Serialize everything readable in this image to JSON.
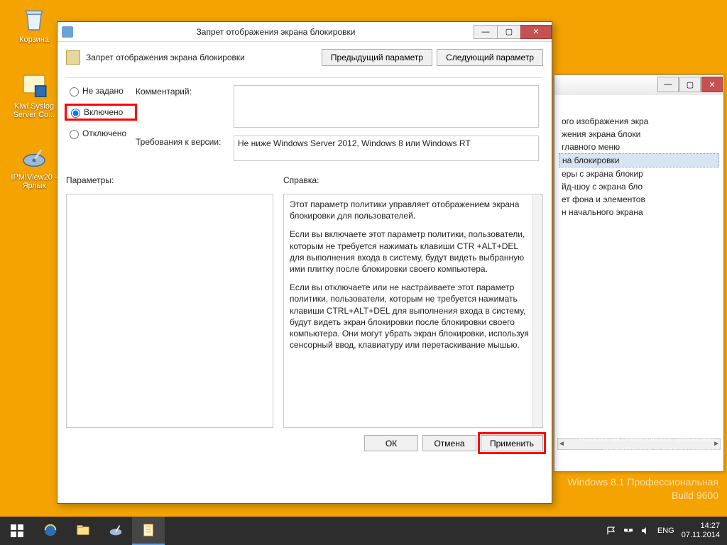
{
  "desktop": {
    "icons": [
      {
        "label": "Корзина"
      },
      {
        "label": "Kiwi Syslog Server Co..."
      },
      {
        "label": "IPMIView20 - Ярлык"
      }
    ]
  },
  "bg_window": {
    "items": [
      "ого изображения экра",
      "жения экрана блоки",
      "главного меню",
      "на блокировки",
      "еры с экрана блокир",
      "йд-шоу с экрана бло",
      "ет фона и элементов",
      "н начального экрана"
    ],
    "selected_index": 3
  },
  "dialog": {
    "title": "Запрет отображения экрана блокировки",
    "header_text": "Запрет отображения экрана блокировки",
    "prev_btn": "Предыдущий параметр",
    "next_btn": "Следующий параметр",
    "radios": {
      "not_configured": "Не задано",
      "enabled": "Включено",
      "disabled": "Отключено",
      "selected": "enabled"
    },
    "comment_label": "Комментарий:",
    "comment_value": "",
    "requirements_label": "Требования к версии:",
    "requirements_value": "Не ниже Windows Server 2012, Windows 8 или Windows RT",
    "params_label": "Параметры:",
    "help_label": "Справка:",
    "help_p1": "Этот параметр политики управляет отображением экрана блокировки для пользователей.",
    "help_p2": "Если вы включаете этот параметр политики, пользователи, которым не требуется нажимать клавиши CTR +ALT+DEL для выполнения входа в систему, будут видеть выбранную ими плитку после блокировки своего компьютера.",
    "help_p3": "Если вы отключаете или не настраиваете этот параметр политики, пользователи, которым не требуется нажимать клавиши CTRL+ALT+DEL для выполнения входа в систему, будут видеть экран блокировки после блокировки своего компьютера. Они могут убрать экран блокировки, используя сенсорный ввод, клавиатуру или перетаскивание мышью.",
    "ok_btn": "ОК",
    "cancel_btn": "Отмена",
    "apply_btn": "Применить"
  },
  "watermark": {
    "title": "Активация Windows",
    "line1": "Чтобы активировать Windows,",
    "line2": "перейдите к параметрам",
    "line3": "компьютера.",
    "build1": "Windows 8.1 Профессиональная",
    "build2": "Build 9600"
  },
  "taskbar": {
    "lang": "ENG",
    "time": "14:27",
    "date": "07.11.2014"
  }
}
